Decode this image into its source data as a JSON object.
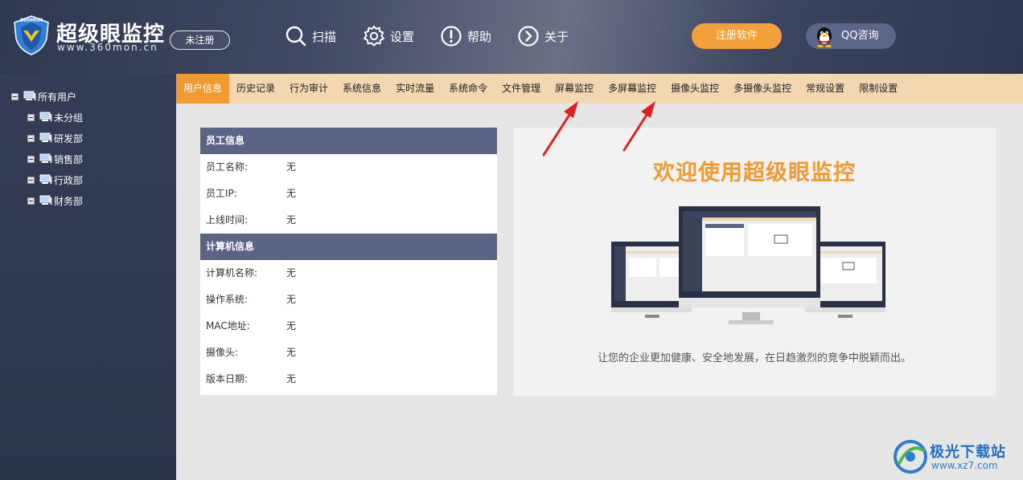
{
  "header": {
    "app_title": "超级眼监控",
    "app_url": "www.360mon.cn",
    "logo_badge": "360MON",
    "unregistered_label": "未注册",
    "nav": [
      {
        "label": "扫描",
        "icon": "search-icon"
      },
      {
        "label": "设置",
        "icon": "gear-icon"
      },
      {
        "label": "帮助",
        "icon": "help-icon"
      },
      {
        "label": "关于",
        "icon": "about-icon"
      }
    ],
    "register_button": "注册软件",
    "qq_button": "QQ咨询"
  },
  "sidebar": {
    "root": "所有用户",
    "groups": [
      "未分组",
      "研发部",
      "销售部",
      "行政部",
      "财务部"
    ]
  },
  "tabs": {
    "items": [
      "用户信息",
      "历史记录",
      "行为审计",
      "系统信息",
      "实时流量",
      "系统命令",
      "文件管理",
      "屏幕监控",
      "多屏幕监控",
      "摄像头监控",
      "多摄像头监控",
      "常规设置",
      "限制设置"
    ],
    "active": "用户信息"
  },
  "employee_info": {
    "heading": "员工信息",
    "rows": [
      {
        "label": "员工名称:",
        "value": "无"
      },
      {
        "label": "员工IP:",
        "value": "无"
      },
      {
        "label": "上线时间:",
        "value": "无"
      }
    ]
  },
  "computer_info": {
    "heading": "计算机信息",
    "rows": [
      {
        "label": "计算机名称:",
        "value": "无"
      },
      {
        "label": "操作系统:",
        "value": "无"
      },
      {
        "label": "MAC地址:",
        "value": "无"
      },
      {
        "label": "摄像头:",
        "value": "无"
      },
      {
        "label": "版本日期:",
        "value": "无"
      }
    ]
  },
  "welcome": {
    "title": "欢迎使用超级眼监控",
    "subtitle": "让您的企业更加健康、安全地发展，在日趋激烈的竞争中脱颖而出。"
  },
  "watermark": {
    "title": "极光下载站",
    "url": "www.xz7.com"
  },
  "colors": {
    "accent_orange": "#f09a2f",
    "header_navy": "#3a4460",
    "section_head": "#5a6486",
    "tabbar_bg": "#f2d7b0",
    "arrow_red": "#e02020"
  }
}
